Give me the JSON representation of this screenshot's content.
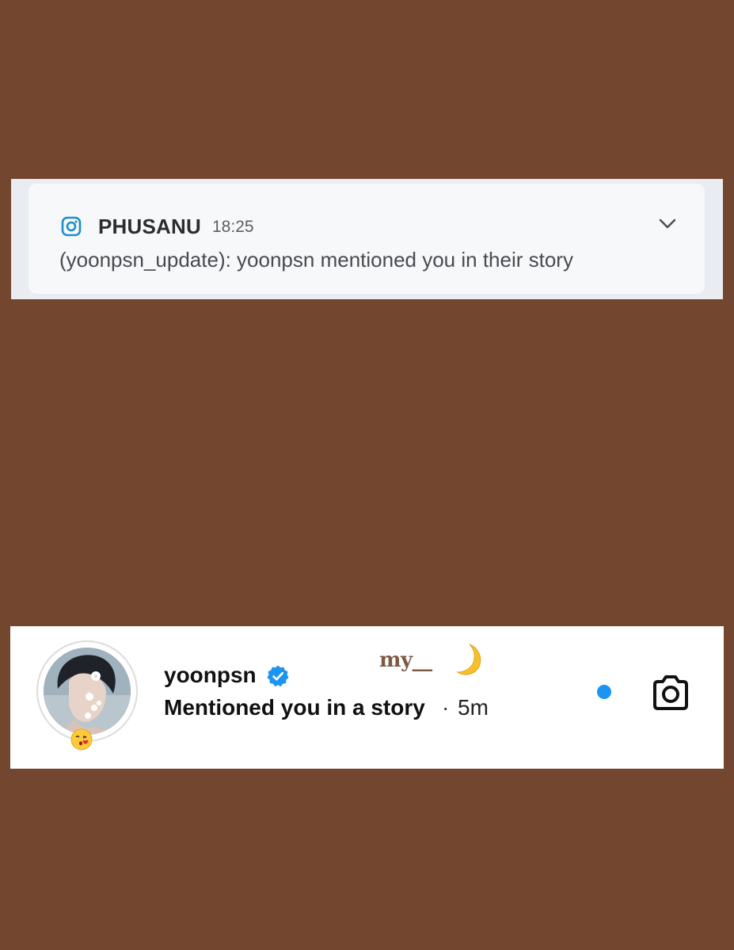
{
  "colors": {
    "background": "#73462f",
    "notification_strip": "#e9ecf0",
    "notification_card": "#f7f8f9",
    "instagram_icon": "#1c8fc8",
    "verified_badge": "#1d95f0",
    "unread_dot": "#1d95f0"
  },
  "notification": {
    "app_icon": "instagram-icon",
    "sender": "PHUSANU",
    "time": "18:25",
    "message": "(yoonpsn_update): yoonpsn mentioned you in their story",
    "expand_icon": "chevron-down-icon"
  },
  "activity": {
    "avatar_icon": "profile-photo",
    "avatar_emoji": "kissing-heart-emoji",
    "username": "yoonpsn",
    "verified_icon": "verified-badge-icon",
    "text": "Mentioned you in a story",
    "separator": "·",
    "time": "5m",
    "unread_indicator": "unread-dot",
    "action_icon": "camera-icon"
  },
  "watermark": {
    "text": "my__",
    "moon_icon": "crescent-moon-icon"
  }
}
